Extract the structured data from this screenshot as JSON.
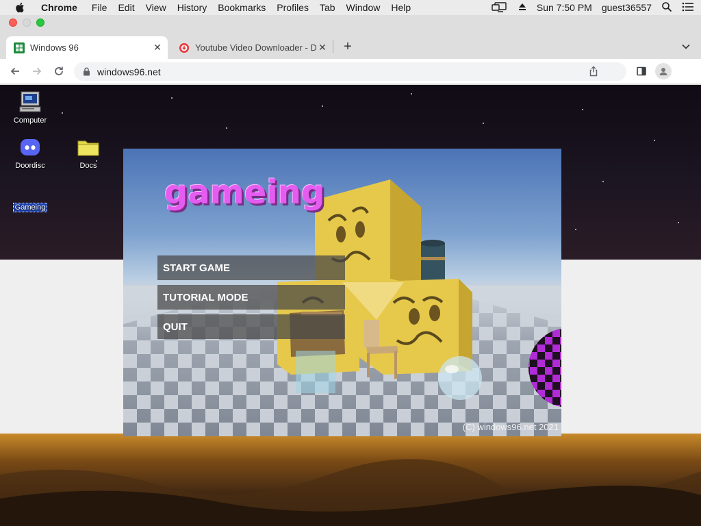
{
  "menubar": {
    "app_name": "Chrome",
    "items": [
      "File",
      "Edit",
      "View",
      "History",
      "Bookmarks",
      "Profiles",
      "Tab",
      "Window",
      "Help"
    ],
    "clock": "Sun 7:50 PM",
    "user": "guest36557"
  },
  "tabs": [
    {
      "title": "Windows 96",
      "active": true,
      "favicon": "windows96-icon"
    },
    {
      "title": "Youtube Video Downloader - D",
      "active": false,
      "favicon": "download-icon"
    }
  ],
  "toolbar": {
    "url": "windows96.net"
  },
  "desktop": {
    "icons": [
      {
        "label": "Computer",
        "icon": "computer-icon"
      },
      {
        "label": "Doordisc",
        "icon": "discord-icon"
      },
      {
        "label": "Docs",
        "icon": "folder-icon"
      },
      {
        "label": "Gameing",
        "icon": "game-shortcut"
      }
    ]
  },
  "game": {
    "title": "gameing",
    "menu": [
      "START GAME",
      "TUTORIAL MODE",
      "QUIT"
    ],
    "copyright": "(C) windows96.net 2021"
  },
  "colors": {
    "game_title": "#e45cf0",
    "menu_button_bg": "rgba(70,70,70,0.72)",
    "sky_top": "#4c74b6",
    "crate": "#e6c84b"
  }
}
